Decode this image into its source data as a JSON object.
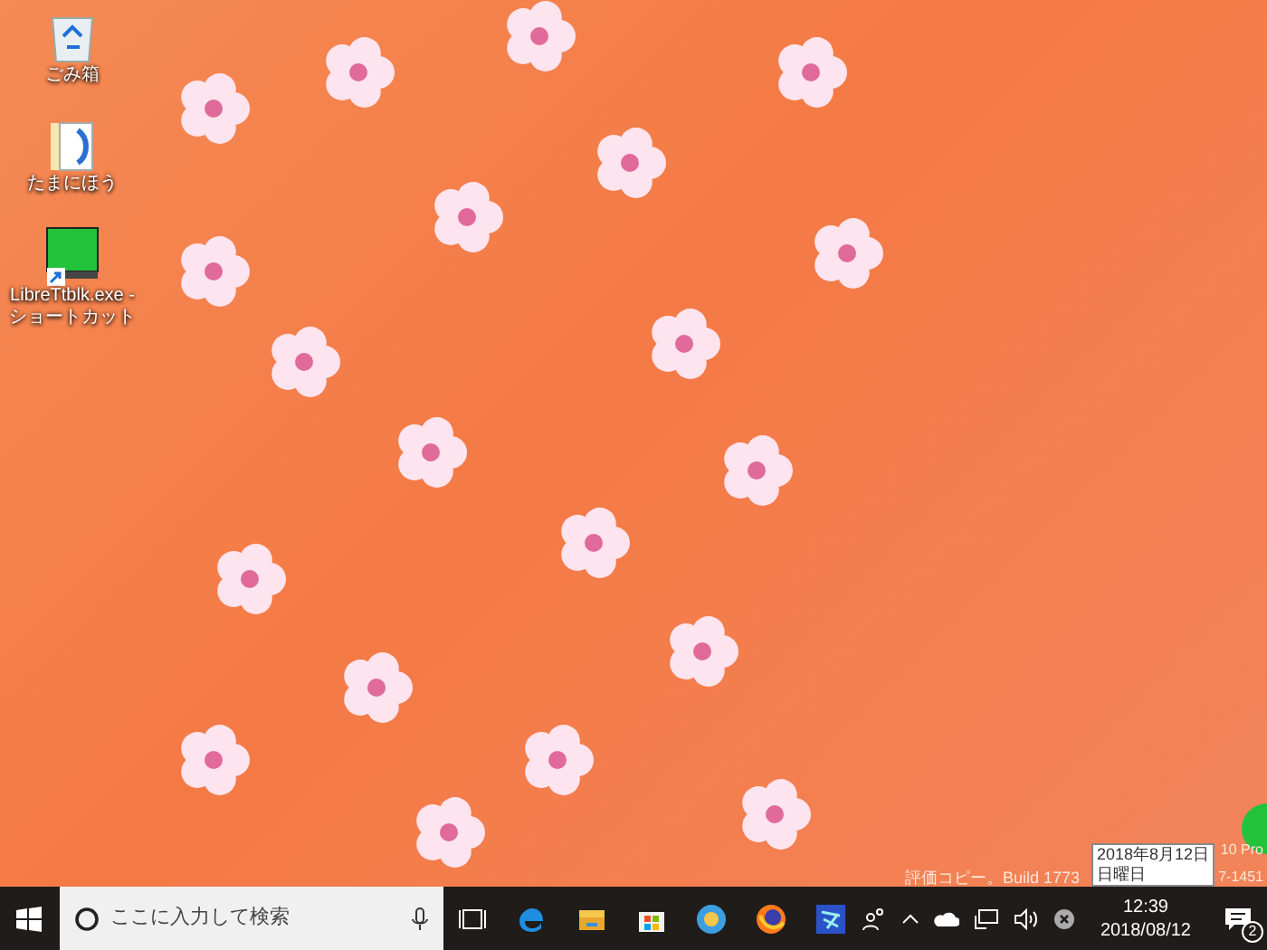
{
  "desktop_icons": [
    {
      "kind": "recycle-bin",
      "label": "ごみ箱"
    },
    {
      "kind": "folder",
      "label": "たまにほう"
    },
    {
      "kind": "shortcut",
      "label": "LibreTtblk.exe - ショートカット"
    }
  ],
  "watermark": {
    "left": "評価コピー。Build 1773",
    "edition": "10 Pro",
    "code": "7-1451"
  },
  "date_tooltip": {
    "date": "2018年8月12日",
    "weekday": "日曜日"
  },
  "taskbar": {
    "search": {
      "placeholder": "ここに入力して検索"
    },
    "apps": [
      {
        "kind": "task-view"
      },
      {
        "kind": "edge"
      },
      {
        "kind": "explorer"
      },
      {
        "kind": "store"
      },
      {
        "kind": "globe"
      },
      {
        "kind": "firefox"
      },
      {
        "kind": "app"
      }
    ],
    "clock": {
      "time": "12:39",
      "date": "2018/08/12"
    },
    "notifications": {
      "count": "2"
    }
  }
}
